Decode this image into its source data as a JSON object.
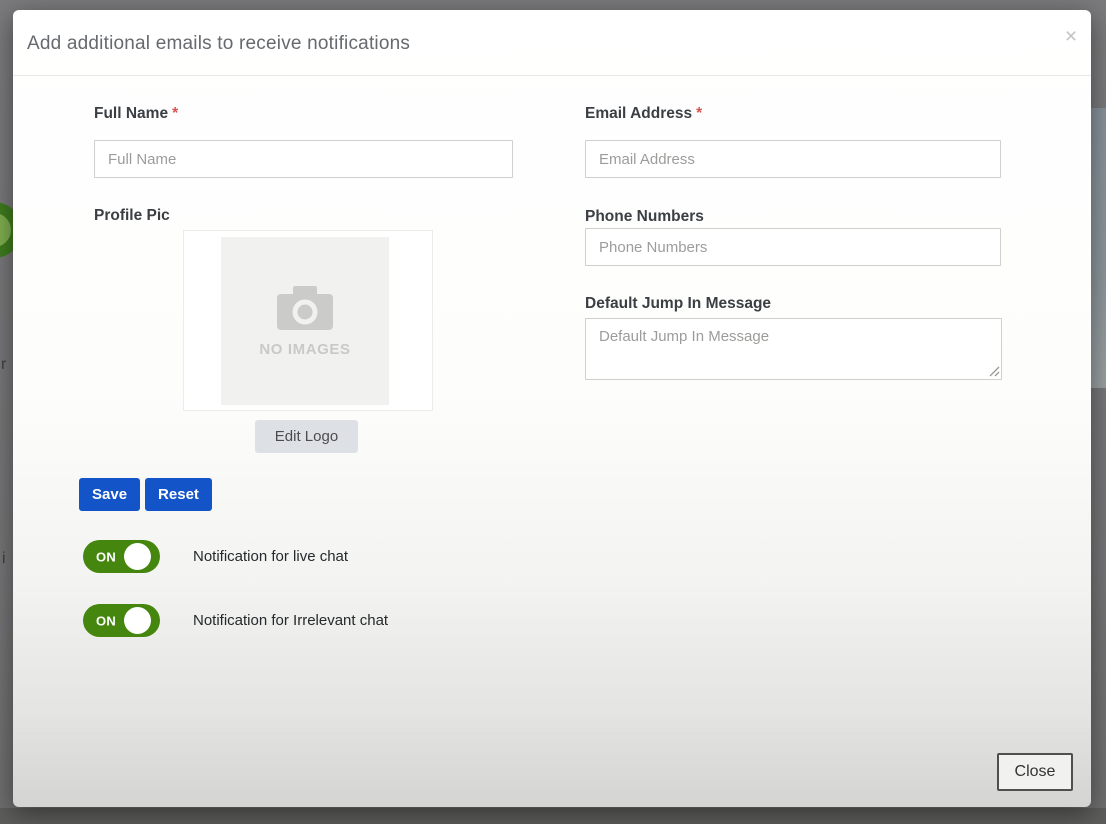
{
  "backdrop": {
    "fragment_r": "r",
    "fragment_i": "i"
  },
  "modal": {
    "title": "Add additional emails to receive notifications",
    "close_icon": "×",
    "form": {
      "full_name": {
        "label": "Full Name",
        "required": "*",
        "placeholder": "Full Name"
      },
      "email_address": {
        "label": "Email Address",
        "required": "*",
        "placeholder": "Email Address"
      },
      "profile_pic": {
        "label": "Profile Pic",
        "empty_state": "NO IMAGES",
        "edit_button": "Edit Logo"
      },
      "phone_numbers": {
        "label": "Phone Numbers",
        "placeholder": "Phone Numbers"
      },
      "default_jump_in_message": {
        "label": "Default Jump In Message",
        "placeholder": "Default Jump In Message"
      }
    },
    "actions": {
      "save": "Save",
      "reset": "Reset"
    },
    "toggles": [
      {
        "state": "ON",
        "label": "Notification for live chat"
      },
      {
        "state": "ON",
        "label": "Notification for Irrelevant chat"
      }
    ],
    "footer": {
      "close": "Close"
    }
  },
  "colors": {
    "primary_button": "#1355c8",
    "toggle_on": "#45870e",
    "required_marker": "#d9534f"
  }
}
